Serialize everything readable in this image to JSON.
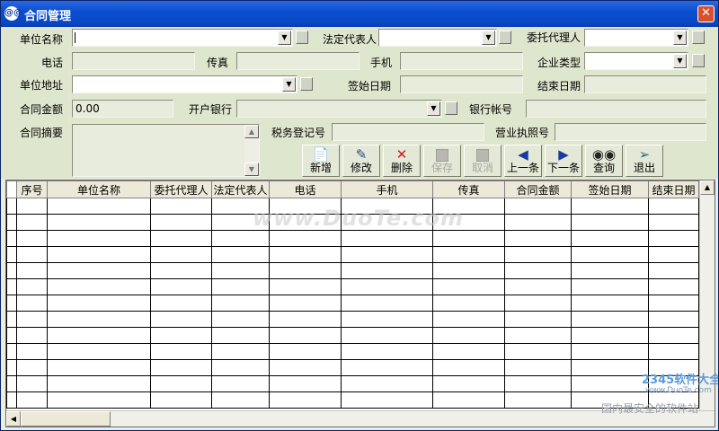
{
  "window": {
    "title": "合同管理",
    "close_glyph": "✕",
    "app_icon": "@@"
  },
  "form": {
    "unit_name": {
      "label": "单位名称",
      "value": ""
    },
    "legal_rep": {
      "label": "法定代表人",
      "value": ""
    },
    "agent": {
      "label": "委托代理人",
      "value": ""
    },
    "phone": {
      "label": "电话",
      "value": ""
    },
    "fax": {
      "label": "传真",
      "value": ""
    },
    "mobile": {
      "label": "手机",
      "value": ""
    },
    "company_type": {
      "label": "企业类型",
      "value": ""
    },
    "address": {
      "label": "单位地址",
      "value": ""
    },
    "sign_date": {
      "label": "签始日期",
      "value": ""
    },
    "end_date": {
      "label": "结束日期",
      "value": ""
    },
    "amount": {
      "label": "合同金额",
      "value": "0.00"
    },
    "bank": {
      "label": "开户银行",
      "value": ""
    },
    "bank_account": {
      "label": "银行帐号",
      "value": ""
    },
    "summary": {
      "label": "合同摘要",
      "value": ""
    },
    "tax_no": {
      "label": "税务登记号",
      "value": ""
    },
    "license_no": {
      "label": "营业执照号",
      "value": ""
    }
  },
  "toolbar": {
    "new": {
      "label": "新增",
      "icon": "new-document-icon"
    },
    "edit": {
      "label": "修改",
      "icon": "edit-icon"
    },
    "delete": {
      "label": "删除",
      "icon": "delete-x-icon"
    },
    "save": {
      "label": "保存",
      "icon": "save-icon",
      "disabled": true
    },
    "cancel": {
      "label": "取消",
      "icon": "cancel-icon",
      "disabled": true
    },
    "prev": {
      "label": "上一条",
      "icon": "arrow-left-icon"
    },
    "next": {
      "label": "下一条",
      "icon": "arrow-right-icon"
    },
    "query": {
      "label": "查询",
      "icon": "binoculars-icon"
    },
    "exit": {
      "label": "退出",
      "icon": "exit-door-icon"
    }
  },
  "grid": {
    "columns": [
      "",
      "序号",
      "单位名称",
      "委托代理人",
      "法定代表人",
      "电话",
      "手机",
      "传真",
      "合同金额",
      "签始日期",
      "结束日期"
    ],
    "empty_row_count": 13
  },
  "watermark": {
    "text": "www.DuoTe.com"
  },
  "corner_logo": {
    "main": "2345软件大全",
    "sub": "www.DuoTe.com",
    "slogan": "国内最安全的软件站"
  }
}
